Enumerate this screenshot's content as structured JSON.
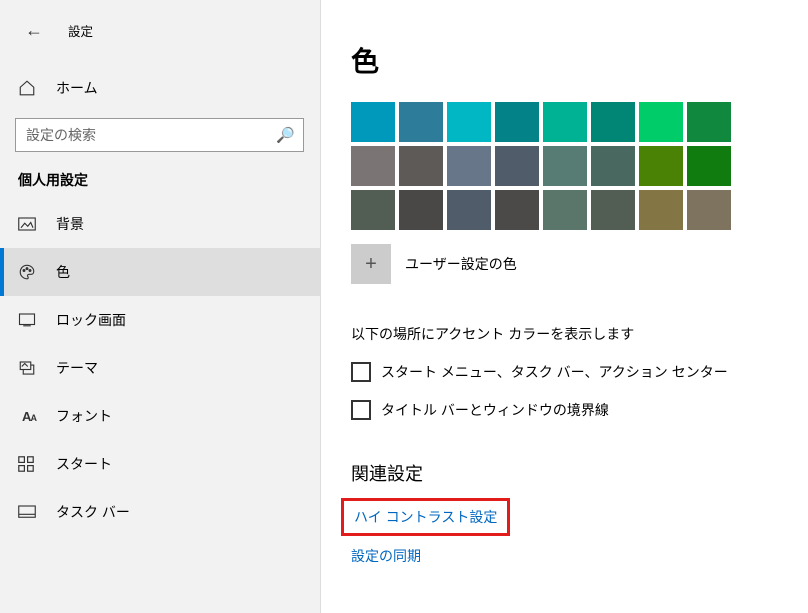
{
  "header": {
    "title": "設定"
  },
  "home": {
    "label": "ホーム"
  },
  "search": {
    "placeholder": "設定の検索"
  },
  "section_heading": "個人用設定",
  "nav": [
    {
      "label": "背景",
      "key": "background"
    },
    {
      "label": "色",
      "key": "colors"
    },
    {
      "label": "ロック画面",
      "key": "lock-screen"
    },
    {
      "label": "テーマ",
      "key": "themes"
    },
    {
      "label": "フォント",
      "key": "fonts"
    },
    {
      "label": "スタート",
      "key": "start"
    },
    {
      "label": "タスク バー",
      "key": "taskbar"
    }
  ],
  "main": {
    "title": "色",
    "colors": [
      [
        "#0099bc",
        "#2d7d9a",
        "#00b7c3",
        "#038387",
        "#00b294",
        "#018574",
        "#00cc6a",
        "#10893e"
      ],
      [
        "#7a7574",
        "#5d5a58",
        "#68768a",
        "#515c6b",
        "#567c73",
        "#486860",
        "#498205",
        "#107c10"
      ],
      [
        "#525e54",
        "#4a4846",
        "#515c6b",
        "#4c4a48",
        "#5a7569",
        "#525e54",
        "#847545",
        "#7e735f"
      ]
    ],
    "custom_color_label": "ユーザー設定の色",
    "accent_text": "以下の場所にアクセント カラーを表示します",
    "chk1": "スタート メニュー、タスク バー、アクション センター",
    "chk2": "タイトル バーとウィンドウの境界線",
    "related_heading": "関連設定",
    "link_high_contrast": "ハイ コントラスト設定",
    "link_sync": "設定の同期"
  }
}
